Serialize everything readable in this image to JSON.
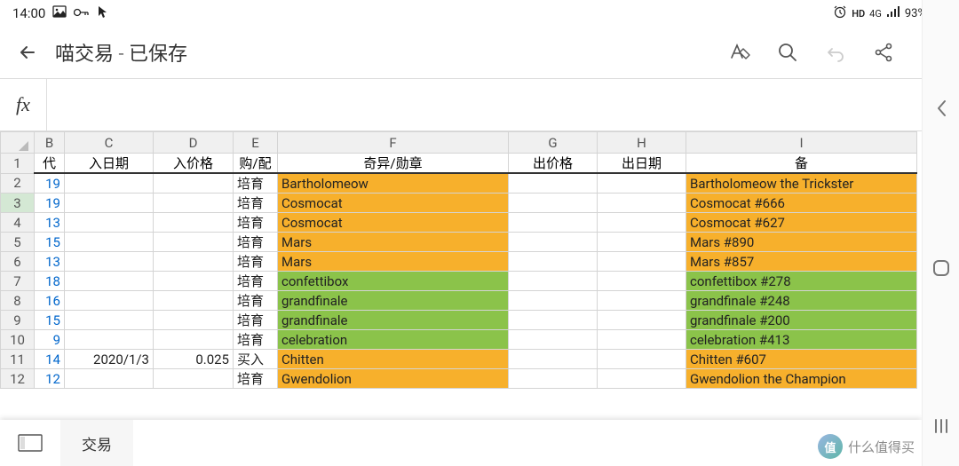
{
  "status": {
    "time": "14:00",
    "hd": "HD",
    "net": "4G",
    "battery": "93%"
  },
  "appbar": {
    "title": "喵交易 - 已保存"
  },
  "fx": {
    "label": "fx"
  },
  "columns": [
    "B",
    "C",
    "D",
    "E",
    "F",
    "G",
    "H",
    "I"
  ],
  "headers": {
    "B": "代",
    "C": "入日期",
    "D": "入价格",
    "E": "购/配",
    "F": "奇异/勋章",
    "G": "出价格",
    "H": "出日期",
    "I": "备"
  },
  "rows": [
    {
      "n": "2",
      "B": "19",
      "C": "",
      "D": "",
      "E": "培育",
      "F": "Bartholomeow",
      "Fbg": "orange",
      "G": "",
      "H": "",
      "I": "Bartholomeow the Trickster",
      "Ibg": "orange"
    },
    {
      "n": "3",
      "B": "19",
      "C": "",
      "D": "",
      "E": "培育",
      "F": "Cosmocat",
      "Fbg": "orange",
      "G": "",
      "H": "",
      "I": "Cosmocat #666",
      "Ibg": "orange",
      "sel": true
    },
    {
      "n": "4",
      "B": "13",
      "C": "",
      "D": "",
      "E": "培育",
      "F": "Cosmocat",
      "Fbg": "orange",
      "G": "",
      "H": "",
      "I": "Cosmocat #627",
      "Ibg": "orange"
    },
    {
      "n": "5",
      "B": "15",
      "C": "",
      "D": "",
      "E": "培育",
      "F": "Mars",
      "Fbg": "orange",
      "G": "",
      "H": "",
      "I": "Mars #890",
      "Ibg": "orange"
    },
    {
      "n": "6",
      "B": "13",
      "C": "",
      "D": "",
      "E": "培育",
      "F": "Mars",
      "Fbg": "orange",
      "G": "",
      "H": "",
      "I": "Mars #857",
      "Ibg": "orange"
    },
    {
      "n": "7",
      "B": "18",
      "C": "",
      "D": "",
      "E": "培育",
      "F": "confettibox",
      "Fbg": "green",
      "G": "",
      "H": "",
      "I": "confettibox #278",
      "Ibg": "green"
    },
    {
      "n": "8",
      "B": "16",
      "C": "",
      "D": "",
      "E": "培育",
      "F": "grandfinale",
      "Fbg": "green",
      "G": "",
      "H": "",
      "I": "grandfinale #248",
      "Ibg": "green"
    },
    {
      "n": "9",
      "B": "15",
      "C": "",
      "D": "",
      "E": "培育",
      "F": "grandfinale",
      "Fbg": "green",
      "G": "",
      "H": "",
      "I": "grandfinale #200",
      "Ibg": "green"
    },
    {
      "n": "10",
      "B": "9",
      "C": "",
      "D": "",
      "E": "培育",
      "F": "celebration",
      "Fbg": "green",
      "G": "",
      "H": "",
      "I": "celebration #413",
      "Ibg": "green"
    },
    {
      "n": "11",
      "B": "14",
      "C": "2020/1/3",
      "D": "0.025",
      "E": "买入",
      "F": "Chitten",
      "Fbg": "orange",
      "G": "",
      "H": "",
      "I": "Chitten #607",
      "Ibg": "orange"
    },
    {
      "n": "12",
      "B": "12",
      "C": "",
      "D": "",
      "E": "培育",
      "F": "Gwendolion",
      "Fbg": "orange",
      "G": "",
      "H": "",
      "I": "Gwendolion the Champion",
      "Ibg": "orange"
    }
  ],
  "sheettab": {
    "name": "交易"
  },
  "watermark": {
    "text": "什么值得买",
    "badge": "值"
  }
}
